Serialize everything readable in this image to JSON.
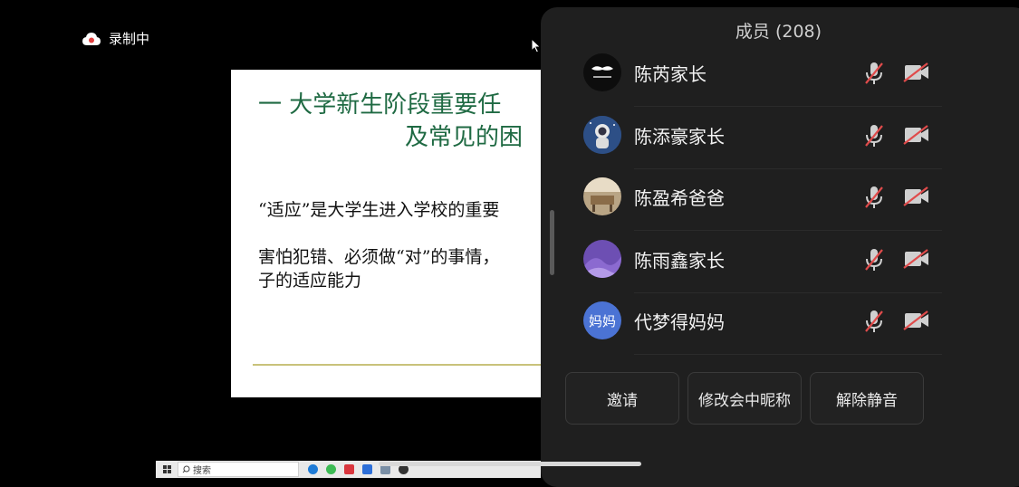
{
  "recording": {
    "label": "录制中"
  },
  "slide": {
    "title_line1": "一  大学新生阶段重要任",
    "title_line2": "及常见的困",
    "paragraph1": "“适应”是大学生进入学校的重要",
    "paragraph2_line1": "害怕犯错、必须做“对”的事情，",
    "paragraph2_line2": "子的适应能力"
  },
  "panel": {
    "title": "成员 (208)",
    "members": [
      {
        "name": "陈芮家长",
        "avatar": "mustache-avatar",
        "mic": "mic-muted-icon",
        "camera": "camera-off-icon"
      },
      {
        "name": "陈添豪家长",
        "avatar": "astronaut-avatar",
        "mic": "mic-muted-icon",
        "camera": "camera-off-icon"
      },
      {
        "name": "陈盈希爸爸",
        "avatar": "room-photo-avatar",
        "mic": "mic-muted-icon",
        "camera": "camera-off-icon"
      },
      {
        "name": "陈雨鑫家长",
        "avatar": "lavender-avatar",
        "mic": "mic-muted-icon",
        "camera": "camera-off-icon"
      },
      {
        "name": "代梦得妈妈",
        "avatar_text": "妈妈",
        "mic": "mic-muted-icon",
        "camera": "camera-off-icon"
      }
    ],
    "buttons": {
      "invite": "邀请",
      "rename": "修改会中昵称",
      "unmute": "解除静音"
    }
  },
  "taskbar": {
    "search_placeholder": "搜索"
  },
  "colors": {
    "panel_bg": "#1f1f1f",
    "slide_title": "#1f6a43",
    "avatar_blue": "#4b73d4",
    "muted_red": "#e04b4b"
  }
}
